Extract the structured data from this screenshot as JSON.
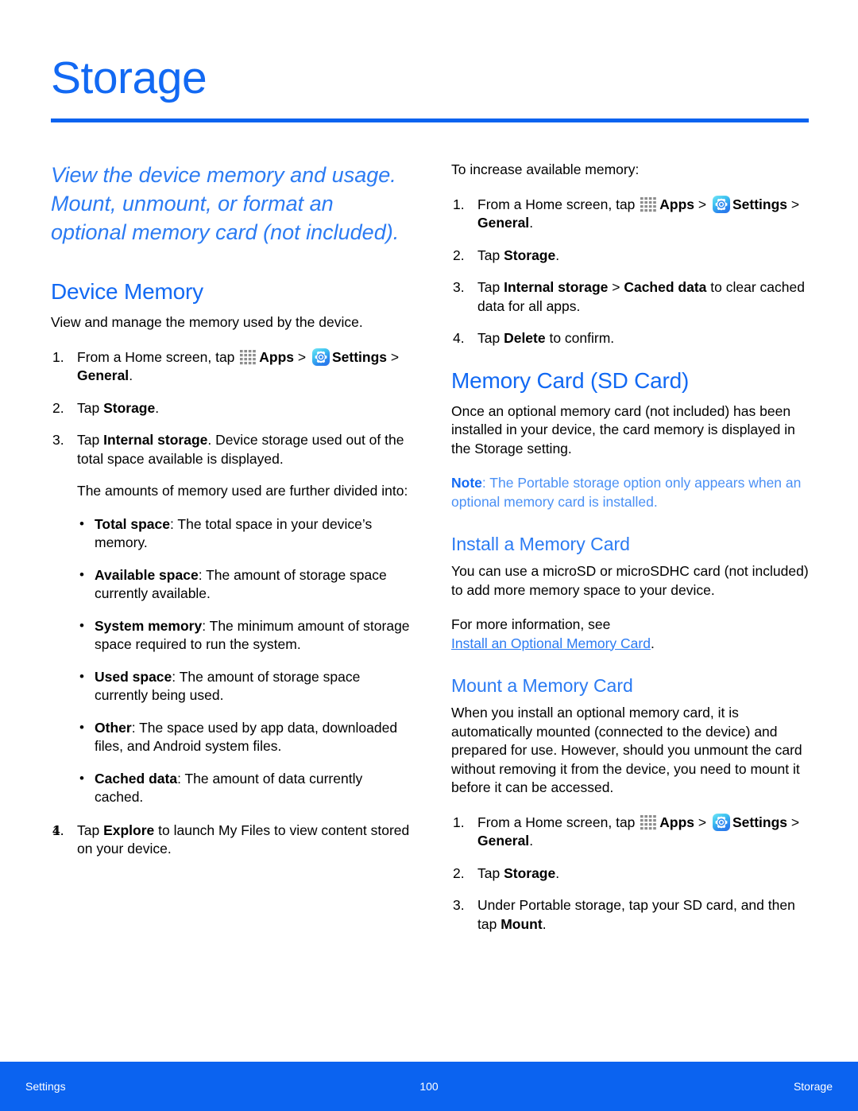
{
  "header": {
    "title": "Storage",
    "rule_color": "#0b63f0"
  },
  "colors": {
    "title_blue": "#1269f3",
    "heading_blue": "#1269f3",
    "subheading_blue": "#2b7bf3",
    "note_blue": "#4a90f5",
    "link_blue": "#2b7bf3",
    "footer_blue": "#0b63f0",
    "body_black": "#000000",
    "apps_icon_gray": "#8c8c8c"
  },
  "icons": {
    "apps": "apps-grid-icon",
    "settings": "settings-gear-icon"
  },
  "left_column": {
    "intro": "View the device memory and usage. Mount, unmount, or format an optional memory card (not included).",
    "device_memory": {
      "heading": "Device Memory",
      "intro": "View and manage the memory used by the device.",
      "steps": [
        {
          "parts": [
            {
              "type": "text",
              "value": "From a Home screen, tap "
            },
            {
              "type": "icon",
              "value": "apps"
            },
            {
              "type": "bold",
              "value": "Apps"
            },
            {
              "type": "text",
              "value": " > "
            },
            {
              "type": "icon",
              "value": "settings"
            },
            {
              "type": "bold",
              "value": "Settings"
            },
            {
              "type": "text",
              "value": " > "
            },
            {
              "type": "bold",
              "value": "General"
            },
            {
              "type": "text",
              "value": "."
            }
          ]
        },
        {
          "parts": [
            {
              "type": "text",
              "value": "Tap "
            },
            {
              "type": "bold",
              "value": "Storage"
            },
            {
              "type": "text",
              "value": "."
            }
          ]
        },
        {
          "parts": [
            {
              "type": "text",
              "value": "Tap "
            },
            {
              "type": "bold",
              "value": "Internal storage"
            },
            {
              "type": "text",
              "value": ". Device storage used out of the total space available is displayed."
            }
          ]
        }
      ],
      "divided_intro": "The amounts of memory used are further divided into:",
      "bullets": [
        {
          "term": "Total space",
          "desc": ": The total space in your device’s memory."
        },
        {
          "term": "Available space",
          "desc": ": The amount of storage space currently available."
        },
        {
          "term": "System memory",
          "desc": ": The minimum amount of storage space required to run the system."
        },
        {
          "term": "Used space",
          "desc": ": The amount of storage space currently being used."
        },
        {
          "term": "Other",
          "desc": ": The space used by app data, downloaded files, and Android system files."
        },
        {
          "term": "Cached data",
          "desc": ": The amount of data currently cached."
        }
      ],
      "last_step": {
        "number": "4.",
        "parts": [
          {
            "type": "text",
            "value": "Tap "
          },
          {
            "type": "bold",
            "value": "Explore"
          },
          {
            "type": "text",
            "value": " to launch My Files to view content stored on your device."
          }
        ]
      }
    }
  },
  "right_column": {
    "increase_memory": {
      "intro": "To increase available memory:",
      "steps": [
        {
          "parts": [
            {
              "type": "text",
              "value": "From a Home screen, tap "
            },
            {
              "type": "icon",
              "value": "apps"
            },
            {
              "type": "bold",
              "value": "Apps"
            },
            {
              "type": "text",
              "value": " > "
            },
            {
              "type": "icon",
              "value": "settings"
            },
            {
              "type": "bold",
              "value": "Settings"
            },
            {
              "type": "text",
              "value": " > "
            },
            {
              "type": "bold",
              "value": "General"
            },
            {
              "type": "text",
              "value": "."
            }
          ]
        },
        {
          "parts": [
            {
              "type": "text",
              "value": "Tap "
            },
            {
              "type": "bold",
              "value": "Storage"
            },
            {
              "type": "text",
              "value": "."
            }
          ]
        },
        {
          "parts": [
            {
              "type": "text",
              "value": "Tap "
            },
            {
              "type": "bold",
              "value": "Internal storage"
            },
            {
              "type": "text",
              "value": " > "
            },
            {
              "type": "bold",
              "value": "Cached data"
            },
            {
              "type": "text",
              "value": " to clear cached data for all apps."
            }
          ]
        },
        {
          "parts": [
            {
              "type": "text",
              "value": "Tap "
            },
            {
              "type": "bold",
              "value": "Delete"
            },
            {
              "type": "text",
              "value": " to confirm."
            }
          ]
        }
      ]
    },
    "memory_card": {
      "heading": "Memory Card (SD Card)",
      "intro": "Once an optional memory card (not included) has been installed in your device, the card memory is displayed in the Storage setting.",
      "note_label": "Note",
      "note_text": ": The Portable storage option only appears when an optional memory card is installed."
    },
    "install_card": {
      "heading": "Install a Memory Card",
      "body": "You can use a microSD or microSDHC card (not included) to add more memory space to your device.",
      "see_also_prefix": "For more information, see",
      "link_text": "Install an Optional Memory Card",
      "see_also_suffix": "."
    },
    "mount_card": {
      "heading": "Mount a Memory Card",
      "body": "When you install an optional memory card, it is automatically mounted (connected to the device) and prepared for use. However, should you unmount the card without removing it from the device, you need to mount it before it can be accessed.",
      "steps": [
        {
          "parts": [
            {
              "type": "text",
              "value": "From a Home screen, tap "
            },
            {
              "type": "icon",
              "value": "apps"
            },
            {
              "type": "bold",
              "value": "Apps"
            },
            {
              "type": "text",
              "value": " > "
            },
            {
              "type": "icon",
              "value": "settings"
            },
            {
              "type": "bold",
              "value": "Settings"
            },
            {
              "type": "text",
              "value": " > "
            },
            {
              "type": "bold",
              "value": "General"
            },
            {
              "type": "text",
              "value": "."
            }
          ]
        },
        {
          "parts": [
            {
              "type": "text",
              "value": "Tap "
            },
            {
              "type": "bold",
              "value": "Storage"
            },
            {
              "type": "text",
              "value": "."
            }
          ]
        },
        {
          "parts": [
            {
              "type": "text",
              "value": "Under Portable storage, tap your SD card, and then tap "
            },
            {
              "type": "bold",
              "value": "Mount"
            },
            {
              "type": "text",
              "value": "."
            }
          ]
        }
      ]
    }
  },
  "footer": {
    "left": "Settings",
    "center": "100",
    "right": "Storage"
  }
}
